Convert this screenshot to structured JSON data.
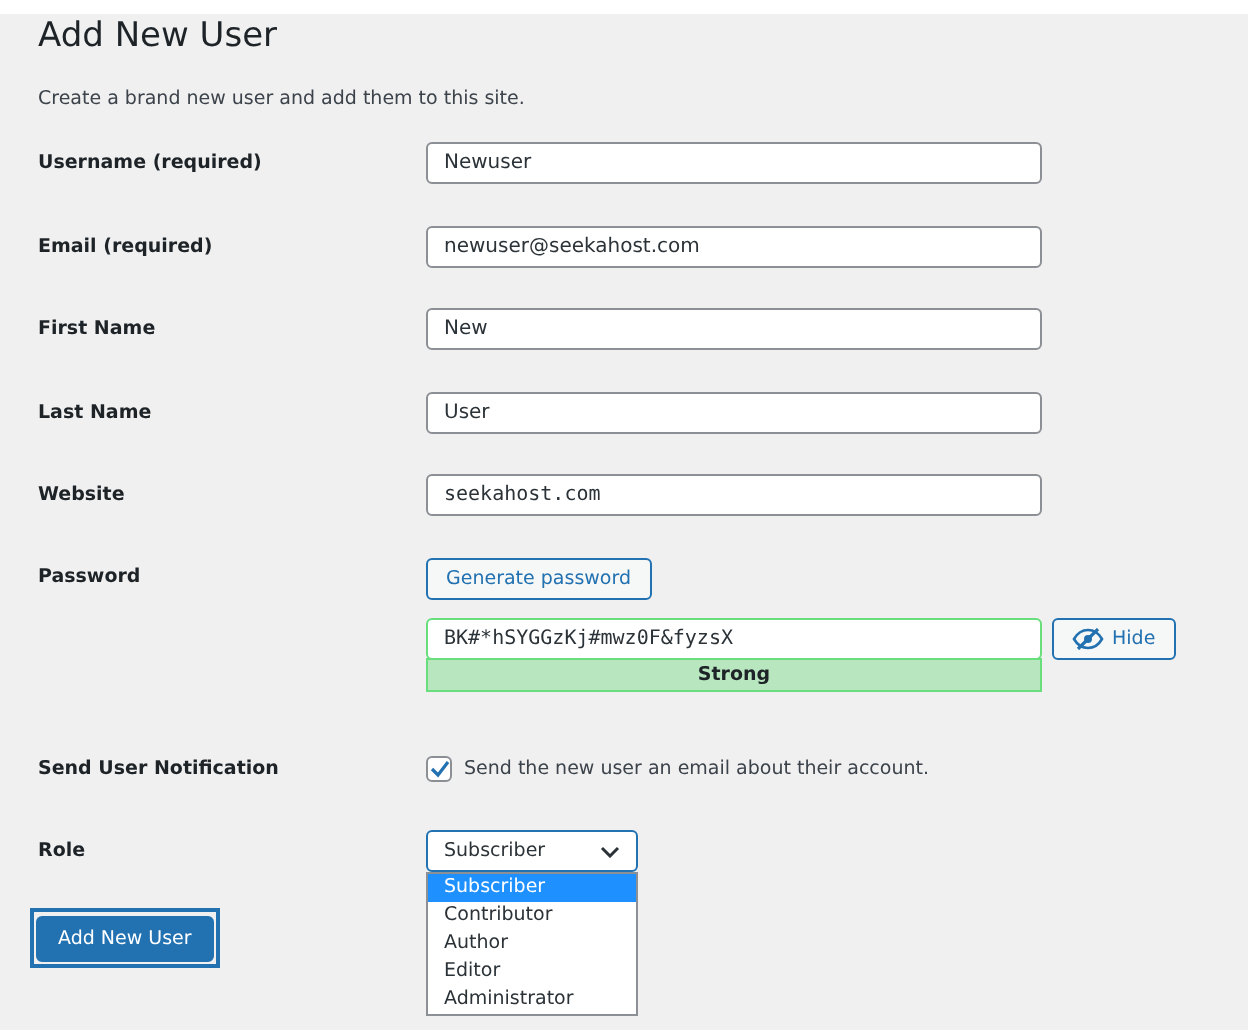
{
  "title": "Add New User",
  "intro": "Create a brand new user and add them to this site.",
  "fields": [
    {
      "label": "Username (required)",
      "value": "Newuser",
      "kind": "text"
    },
    {
      "label": "Email (required)",
      "value": "newuser@seekahost.com",
      "kind": "text"
    },
    {
      "label": "First Name",
      "value": "New",
      "kind": "text"
    },
    {
      "label": "Last Name",
      "value": "User",
      "kind": "text"
    },
    {
      "label": "Website",
      "value": "seekahost.com",
      "kind": "code"
    }
  ],
  "password": {
    "label": "Password",
    "generate_button": "Generate password",
    "value": "BK#*hSYGGzKj#mwz0F&fyzsX",
    "strength": "Strong",
    "level": 1,
    "toggle_button": "Hide"
  },
  "notification": {
    "label": "Send User Notification",
    "checked": true,
    "text": "Send the new user an email about their account."
  },
  "role": {
    "label": "Role",
    "value": "Subscriber",
    "expanded": true,
    "options": [
      {
        "label": "Subscriber",
        "selected": true
      },
      {
        "label": "Contributor",
        "selected": false
      },
      {
        "label": "Author",
        "selected": false
      },
      {
        "label": "Editor",
        "selected": false
      },
      {
        "label": "Administrator",
        "selected": false
      }
    ]
  },
  "submit_button": "Add New User"
}
